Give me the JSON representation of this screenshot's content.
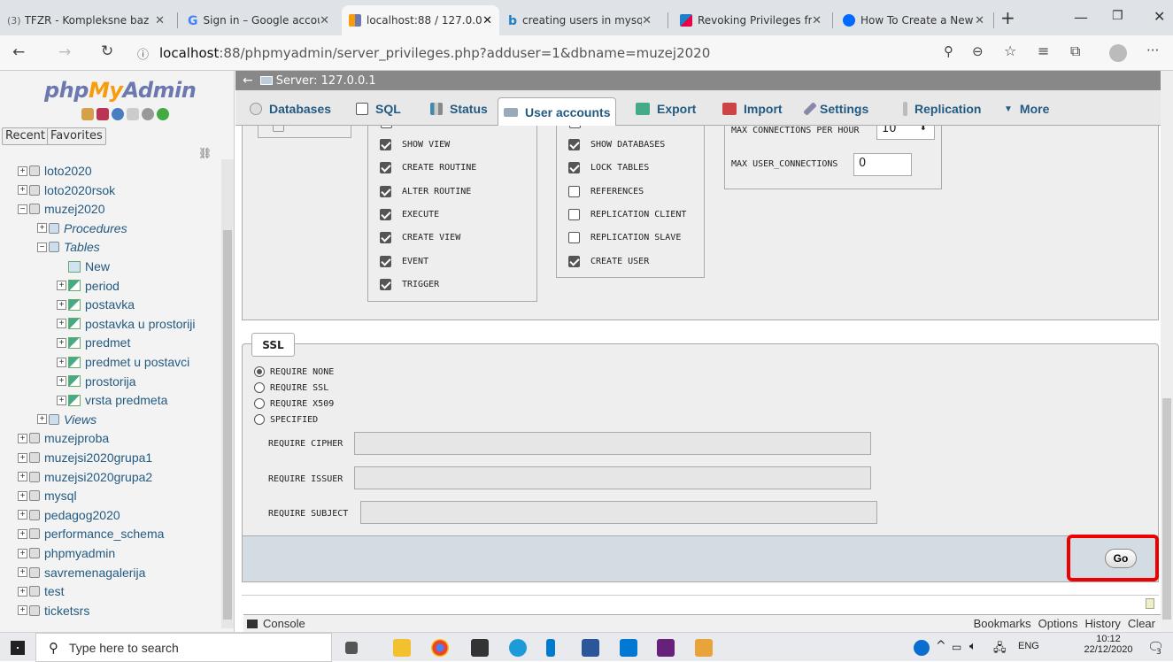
{
  "browser": {
    "tabs": [
      {
        "title": "TFZR - Kompleksne baz",
        "active": false
      },
      {
        "title": "Sign in – Google accour",
        "active": false
      },
      {
        "title": "localhost:88 / 127.0.0.1",
        "active": true
      },
      {
        "title": "creating users in mysql",
        "active": false
      },
      {
        "title": "Revoking Privileges fro",
        "active": false
      },
      {
        "title": "How To Create a New U",
        "active": false
      }
    ],
    "tab_badge": "(3)",
    "new_tab": "+",
    "url_host": "localhost",
    "url_rest": ":88/phpmyadmin/server_privileges.php?adduser=1&dbname=muzej2020"
  },
  "pma": {
    "logo_php": "php",
    "logo_my": "My",
    "logo_admin": "Admin",
    "recent": "Recent",
    "favorites": "Favorites",
    "server_label": "Server: 127.0.0.1",
    "menu": [
      "Databases",
      "SQL",
      "Status",
      "User accounts",
      "Export",
      "Import",
      "Settings",
      "Replication",
      "More"
    ],
    "tree": [
      {
        "label": "loto2020",
        "level": 0,
        "kind": "db"
      },
      {
        "label": "loto2020rsok",
        "level": 0,
        "kind": "db"
      },
      {
        "label": "muzej2020",
        "level": 0,
        "kind": "db",
        "open": true
      },
      {
        "label": "Procedures",
        "level": 1,
        "kind": "group"
      },
      {
        "label": "Tables",
        "level": 1,
        "kind": "group",
        "open": true
      },
      {
        "label": "New",
        "level": 2,
        "kind": "new"
      },
      {
        "label": "period",
        "level": 2,
        "kind": "table"
      },
      {
        "label": "postavka",
        "level": 2,
        "kind": "table"
      },
      {
        "label": "postavka u prostoriji",
        "level": 2,
        "kind": "table"
      },
      {
        "label": "predmet",
        "level": 2,
        "kind": "table"
      },
      {
        "label": "predmet u postavci",
        "level": 2,
        "kind": "table"
      },
      {
        "label": "prostorija",
        "level": 2,
        "kind": "table"
      },
      {
        "label": "vrsta predmeta",
        "level": 2,
        "kind": "table"
      },
      {
        "label": "Views",
        "level": 1,
        "kind": "group"
      },
      {
        "label": "muzejproba",
        "level": 0,
        "kind": "db"
      },
      {
        "label": "muzejsi2020grupa1",
        "level": 0,
        "kind": "db"
      },
      {
        "label": "muzejsi2020grupa2",
        "level": 0,
        "kind": "db"
      },
      {
        "label": "mysql",
        "level": 0,
        "kind": "db"
      },
      {
        "label": "pedagog2020",
        "level": 0,
        "kind": "db"
      },
      {
        "label": "performance_schema",
        "level": 0,
        "kind": "db"
      },
      {
        "label": "phpmyadmin",
        "level": 0,
        "kind": "db"
      },
      {
        "label": "savremenagalerija",
        "level": 0,
        "kind": "db"
      },
      {
        "label": "test",
        "level": 0,
        "kind": "db"
      },
      {
        "label": "ticketsrs",
        "level": 0,
        "kind": "db"
      }
    ],
    "structure_privs": [
      {
        "label": "SHOW VIEW",
        "checked": true
      },
      {
        "label": "CREATE ROUTINE",
        "checked": true
      },
      {
        "label": "ALTER ROUTINE",
        "checked": true
      },
      {
        "label": "EXECUTE",
        "checked": true
      },
      {
        "label": "CREATE VIEW",
        "checked": true
      },
      {
        "label": "EVENT",
        "checked": true
      },
      {
        "label": "TRIGGER",
        "checked": true
      }
    ],
    "admin_privs": [
      {
        "label": "SHOW DATABASES",
        "checked": true
      },
      {
        "label": "LOCK TABLES",
        "checked": true
      },
      {
        "label": "REFERENCES",
        "checked": false
      },
      {
        "label": "REPLICATION CLIENT",
        "checked": false
      },
      {
        "label": "REPLICATION SLAVE",
        "checked": false
      },
      {
        "label": "CREATE USER",
        "checked": true
      }
    ],
    "limits": {
      "max_conn_label": "MAX CONNECTIONS PER HOUR",
      "max_conn_value": "10",
      "max_user_label": "MAX USER_CONNECTIONS",
      "max_user_value": "0"
    },
    "ssl": {
      "legend": "SSL",
      "options": [
        {
          "label": "REQUIRE NONE",
          "selected": true
        },
        {
          "label": "REQUIRE SSL",
          "selected": false
        },
        {
          "label": "REQUIRE X509",
          "selected": false
        },
        {
          "label": "SPECIFIED",
          "selected": false
        }
      ],
      "cipher_label": "REQUIRE CIPHER",
      "issuer_label": "REQUIRE ISSUER",
      "subject_label": "REQUIRE SUBJECT"
    },
    "go_label": "Go",
    "console_label": "Console",
    "console_links": [
      "Bookmarks",
      "Options",
      "History",
      "Clear"
    ]
  },
  "taskbar": {
    "search_placeholder": "Type here to search",
    "lang": "ENG",
    "time": "10:12",
    "date": "22/12/2020",
    "notif_count": "3"
  }
}
